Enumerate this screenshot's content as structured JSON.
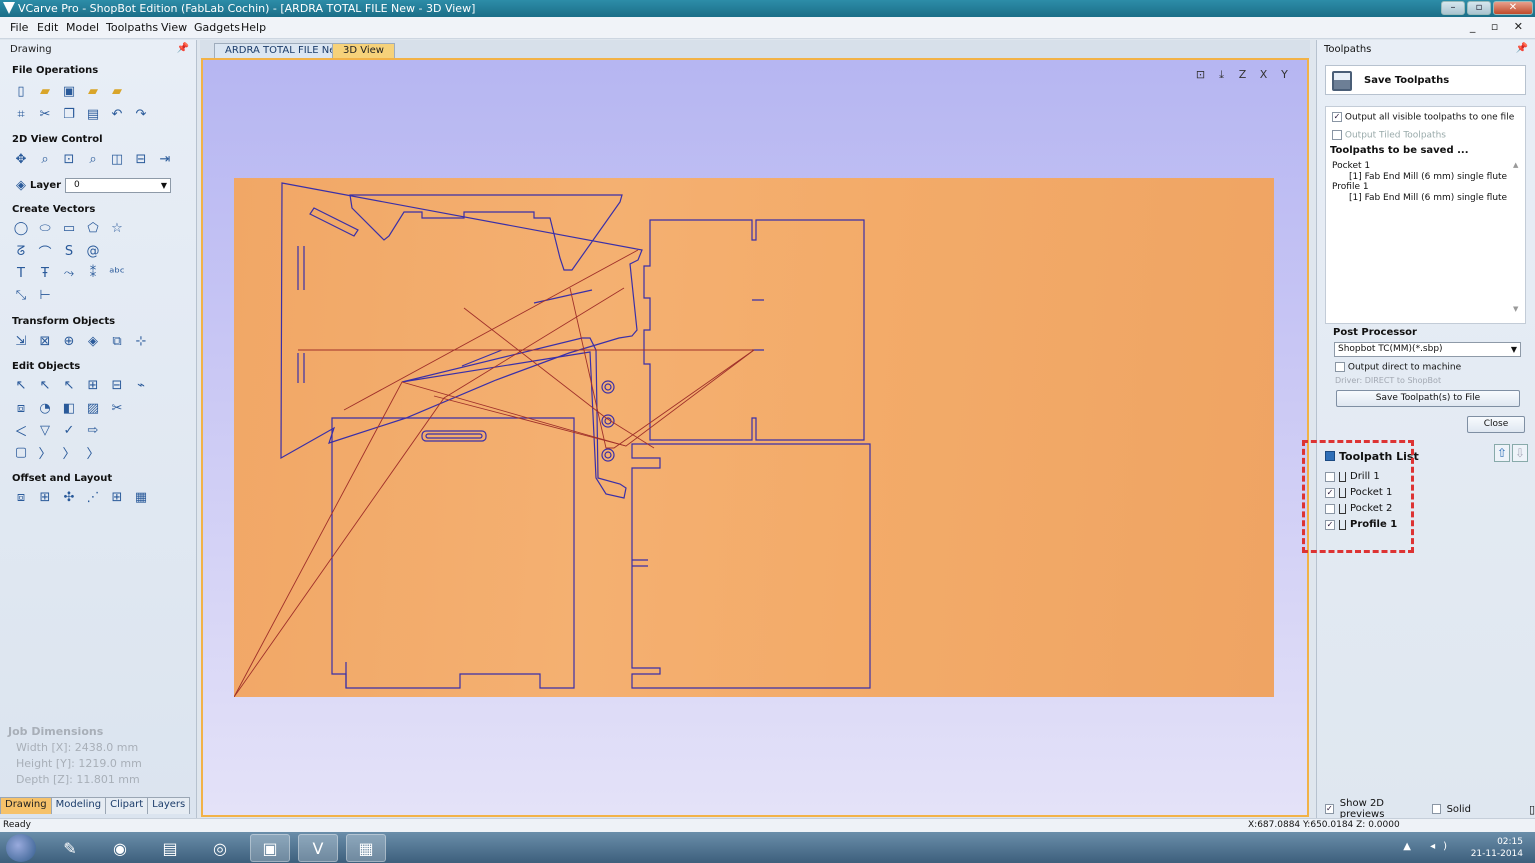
{
  "window": {
    "title": "VCarve Pro - ShopBot Edition (FabLab Cochin) - [ARDRA TOTAL FILE New - 3D View]",
    "controls": [
      "–",
      "▫",
      "✕"
    ]
  },
  "menu": [
    "File",
    "Edit",
    "Model",
    "Toolpaths",
    "View",
    "Gadgets",
    "Help"
  ],
  "mdi_controls": "_ ▫ ✕",
  "left_panel": {
    "title": "Drawing",
    "sections": {
      "file_operations": "File Operations",
      "view_control": "2D View Control",
      "create_vectors": "Create Vectors",
      "transform_objects": "Transform Objects",
      "edit_objects": "Edit Objects",
      "offset_layout": "Offset and Layout"
    },
    "layer_label": "Layer",
    "layer_value": "0",
    "job_dimensions": {
      "heading": "Job Dimensions",
      "width": "Width  [X]: 2438.0 mm",
      "height": "Height [Y]: 1219.0 mm",
      "depth": "Depth  [Z]: 11.801 mm"
    },
    "tabs": [
      "Drawing",
      "Modeling",
      "Clipart",
      "Layers"
    ]
  },
  "doc_tabs": [
    "ARDRA TOTAL FILE New",
    "3D View"
  ],
  "right_panel": {
    "title": "Toolpaths",
    "save_header": "Save Toolpaths",
    "opt_all_visible": "Output all visible toolpaths to one file",
    "opt_tiled": "Output Tiled Toolpaths",
    "to_be_saved_title": "Toolpaths to be saved ...",
    "tree": [
      {
        "name": "Pocket 1",
        "tool": "[1] Fab End Mill (6 mm) single flute"
      },
      {
        "name": "Profile 1",
        "tool": "[1] Fab End Mill (6 mm) single flute"
      }
    ],
    "post_processor_title": "Post Processor",
    "post_processor_value": "Shopbot TC(MM)(*.sbp)",
    "direct_label": "Output direct to machine",
    "driver_text": "Driver: DIRECT to ShopBot",
    "save_button": "Save Toolpath(s) to File",
    "close_button": "Close",
    "toolpath_list_title": "Toolpath List",
    "toolpath_list": [
      {
        "label": "Drill 1",
        "checked": false
      },
      {
        "label": "Pocket 1",
        "checked": true
      },
      {
        "label": "Pocket 2",
        "checked": false
      },
      {
        "label": "Profile 1",
        "checked": true
      }
    ],
    "show_2d_previews": "Show 2D previews",
    "solid": "Solid"
  },
  "status": {
    "ready": "Ready",
    "coords": "X:687.0884 Y:650.0184 Z:  0.0000"
  },
  "taskbar": {
    "time": "02:15",
    "date": "21-11-2014"
  },
  "colors": {
    "accent": "#f2b247",
    "vector_lines": "#3a2fa8",
    "toolpath_lines": "#a0302a",
    "highlight_box": "#dd3333"
  }
}
